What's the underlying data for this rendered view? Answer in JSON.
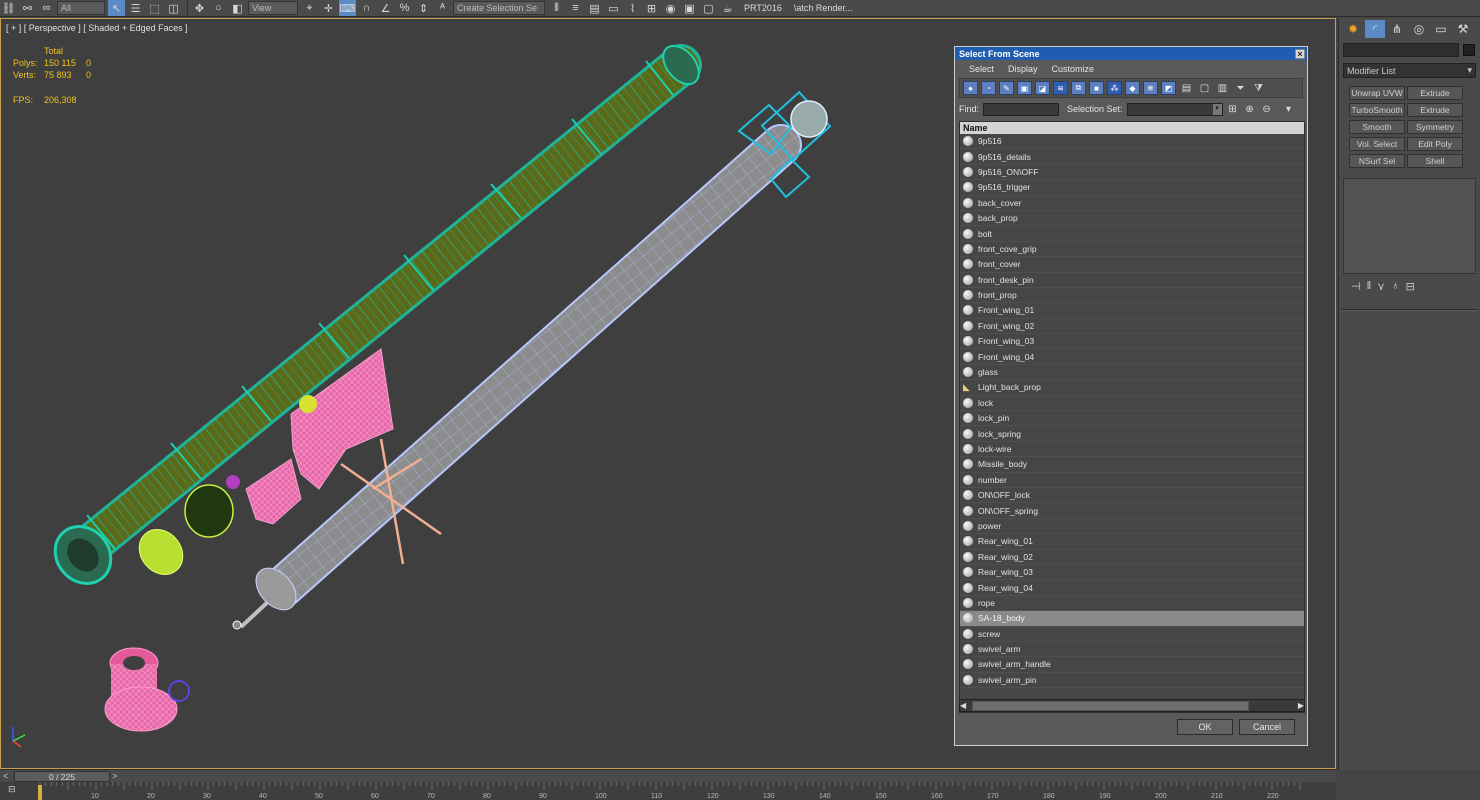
{
  "toolbar": {
    "filter_value": "All",
    "refcoord_value": "View",
    "selection_set_placeholder": "Create Selection Se",
    "prt_label": "PRT2016",
    "batch_label": "\\atch Render..."
  },
  "viewport": {
    "label": "[ + ] [ Perspective ] [ Shaded + Edged Faces ]",
    "stats": {
      "total_header": "Total",
      "polys_label": "Polys:",
      "polys_value": "150 115",
      "polys_sel": "0",
      "verts_label": "Verts:",
      "verts_value": "75 893",
      "verts_sel": "0",
      "fps_label": "FPS:",
      "fps_value": "206,308"
    }
  },
  "command_panel": {
    "modifier_list": "Modifier List",
    "buttons": [
      "Unwrap UVW",
      "Extrude",
      "TurboSmooth",
      "Extrude",
      "Smooth",
      "Symmetry",
      "Vol. Select",
      "Edit Poly",
      "NSurf Sel",
      "Shell"
    ]
  },
  "dialog": {
    "title": "Select From Scene",
    "close": "×",
    "menu": [
      "Select",
      "Display",
      "Customize"
    ],
    "find_label": "Find:",
    "selection_set_label": "Selection Set:",
    "column_name": "Name",
    "items": [
      {
        "name": "9p516",
        "type": "geometry",
        "selected": false
      },
      {
        "name": "9p516_details",
        "type": "geometry",
        "selected": false
      },
      {
        "name": "9p516_ON\\OFF",
        "type": "geometry",
        "selected": false
      },
      {
        "name": "9p516_trigger",
        "type": "geometry",
        "selected": false
      },
      {
        "name": "back_cover",
        "type": "geometry",
        "selected": false
      },
      {
        "name": "back_prop",
        "type": "geometry",
        "selected": false
      },
      {
        "name": "bolt",
        "type": "geometry",
        "selected": false
      },
      {
        "name": "front_cove_grip",
        "type": "geometry",
        "selected": false
      },
      {
        "name": "front_cover",
        "type": "geometry",
        "selected": false
      },
      {
        "name": "front_desk_pin",
        "type": "geometry",
        "selected": false
      },
      {
        "name": "front_prop",
        "type": "geometry",
        "selected": false
      },
      {
        "name": "Front_wing_01",
        "type": "geometry",
        "selected": false
      },
      {
        "name": "Front_wing_02",
        "type": "geometry",
        "selected": false
      },
      {
        "name": "Front_wing_03",
        "type": "geometry",
        "selected": false
      },
      {
        "name": "Front_wing_04",
        "type": "geometry",
        "selected": false
      },
      {
        "name": "glass",
        "type": "geometry",
        "selected": false
      },
      {
        "name": "Light_back_prop",
        "type": "light",
        "selected": false
      },
      {
        "name": "lock",
        "type": "geometry",
        "selected": false
      },
      {
        "name": "lock_pin",
        "type": "geometry",
        "selected": false
      },
      {
        "name": "lock_spring",
        "type": "geometry",
        "selected": false
      },
      {
        "name": "lock-wire",
        "type": "geometry",
        "selected": false
      },
      {
        "name": "Missile_body",
        "type": "geometry",
        "selected": false
      },
      {
        "name": "number",
        "type": "geometry",
        "selected": false
      },
      {
        "name": "ON\\OFF_lock",
        "type": "geometry",
        "selected": false
      },
      {
        "name": "ON\\OFF_spring",
        "type": "geometry",
        "selected": false
      },
      {
        "name": "power",
        "type": "geometry",
        "selected": false
      },
      {
        "name": "Rear_wing_01",
        "type": "geometry",
        "selected": false
      },
      {
        "name": "Rear_wing_02",
        "type": "geometry",
        "selected": false
      },
      {
        "name": "Rear_wing_03",
        "type": "geometry",
        "selected": false
      },
      {
        "name": "Rear_wing_04",
        "type": "geometry",
        "selected": false
      },
      {
        "name": "rope",
        "type": "geometry",
        "selected": false
      },
      {
        "name": "SA-18_body",
        "type": "geometry",
        "selected": true
      },
      {
        "name": "screw",
        "type": "geometry",
        "selected": false
      },
      {
        "name": "swivel_arm",
        "type": "geometry",
        "selected": false
      },
      {
        "name": "swivel_arm_handle",
        "type": "geometry",
        "selected": false
      },
      {
        "name": "swivel_arm_pin",
        "type": "geometry",
        "selected": false
      }
    ],
    "ok_label": "OK",
    "cancel_label": "Cancel"
  },
  "timeline": {
    "frame_counter": "0 / 225",
    "prev": "<",
    "next": ">",
    "ticks": [
      10,
      20,
      30,
      40,
      50,
      60,
      70,
      80,
      90,
      100,
      110,
      120,
      130,
      140,
      150,
      160,
      170,
      180,
      190,
      200,
      210,
      220
    ]
  },
  "colors": {
    "accent": "#1f5db0",
    "viewport_border": "#c8a24a",
    "stats_text": "#f0c020",
    "tube_green": "#5a6a18",
    "wire_teal": "#1fb39a",
    "missile_gray": "#8c8c8c",
    "pink": "#e35a9a"
  }
}
